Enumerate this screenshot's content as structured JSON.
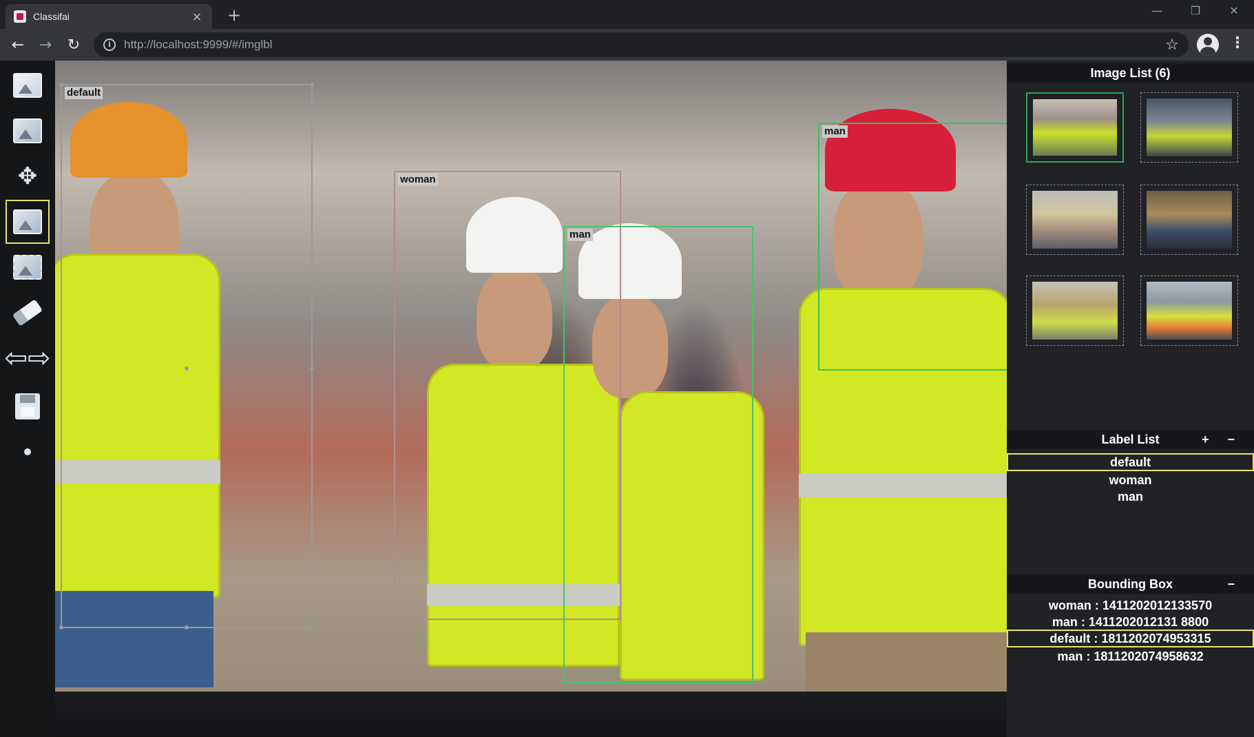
{
  "browser": {
    "tab_title": "Classifai",
    "tab_close": "×",
    "new_tab": "+",
    "url": "http://localhost:9999/#/imglbl",
    "window_controls": {
      "minimize": "—",
      "maximize": "❐",
      "close": "✕"
    },
    "icons": {
      "back": "back-arrow-icon",
      "forward": "forward-arrow-icon",
      "reload": "reload-icon",
      "star": "bookmark-star-icon",
      "profile": "profile-icon",
      "menu": "menu-dots-icon"
    }
  },
  "tools": [
    {
      "name": "open-folder-tool",
      "icon": "folder-icon"
    },
    {
      "name": "add-image-tool",
      "icon": "add-image-icon"
    },
    {
      "name": "move-tool",
      "icon": "move-arrows-icon"
    },
    {
      "name": "bounding-box-tool",
      "icon": "image-select-icon",
      "active": true
    },
    {
      "name": "fit-image-tool",
      "icon": "fit-image-icon"
    },
    {
      "name": "eraser-tool",
      "icon": "eraser-icon"
    },
    {
      "name": "prev-next-tool",
      "icon": "left-right-arrows-icon"
    },
    {
      "name": "save-tool",
      "icon": "save-icon"
    },
    {
      "name": "dot-tool",
      "icon": "dot-icon"
    }
  ],
  "canvas": {
    "boxes": [
      {
        "label": "default",
        "color": "#9a9a9a"
      },
      {
        "label": "woman",
        "color": "#b08d8d"
      },
      {
        "label": "man",
        "color": "#4fbf6a"
      },
      {
        "label": "man",
        "color": "#3bbf5a"
      }
    ]
  },
  "image_list": {
    "title": "Image List (6)",
    "thumbnails": [
      {
        "active": true
      },
      {
        "active": false
      },
      {
        "active": false
      },
      {
        "active": false
      },
      {
        "active": false
      },
      {
        "active": false
      }
    ]
  },
  "label_list": {
    "title": "Label List",
    "add": "+",
    "remove": "−",
    "items": [
      "default",
      "woman",
      "man"
    ],
    "selected": "default"
  },
  "bounding_box": {
    "title": "Bounding Box",
    "remove": "−",
    "items": [
      "woman : 1411202012133570",
      "man : 1411202012131 8800",
      "default : 1811202074953315",
      "man : 1811202074958632"
    ],
    "selected_index": 2
  },
  "colors": {
    "accent_yellow": "#e8e66a",
    "selected_thumb": "#2fa84f"
  }
}
